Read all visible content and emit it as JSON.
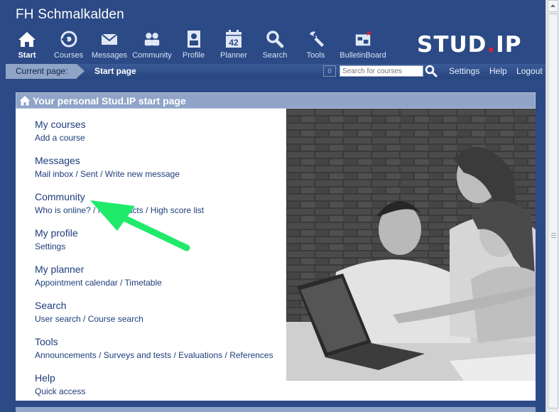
{
  "header": {
    "title": "FH Schmalkalden",
    "logo_main": "STUD",
    "logo_dot": ".",
    "logo_end": "IP"
  },
  "nav": [
    {
      "label": "Start",
      "icon": "home-icon",
      "active": true
    },
    {
      "label": "Courses",
      "icon": "courses-icon"
    },
    {
      "label": "Messages",
      "icon": "envelope-icon"
    },
    {
      "label": "Community",
      "icon": "people-icon"
    },
    {
      "label": "Profile",
      "icon": "profile-icon"
    },
    {
      "label": "Planner",
      "icon": "calendar-icon",
      "badge": "42"
    },
    {
      "label": "Search",
      "icon": "magnifier-icon"
    },
    {
      "label": "Tools",
      "icon": "wrench-icon"
    },
    {
      "label": "BulletinBoard",
      "icon": "bulletinboard-icon"
    }
  ],
  "bar": {
    "current_label": "Current page:",
    "current_page": "Start page",
    "count": "0",
    "search_placeholder": "Search for courses",
    "settings": "Settings",
    "help": "Help",
    "logout": "Logout"
  },
  "panel": {
    "title": "Your personal Stud.IP start page"
  },
  "sections": [
    {
      "title": "My courses",
      "links": [
        "Add a course"
      ]
    },
    {
      "title": "Messages",
      "links": [
        "Mail inbox",
        "Sent",
        "Write new message"
      ]
    },
    {
      "title": "Community",
      "links": [
        "Who is online?",
        "My contacts",
        "High score list"
      ]
    },
    {
      "title": "My profile",
      "links": [
        "Settings"
      ]
    },
    {
      "title": "My planner",
      "links": [
        "Appointment calendar",
        "Timetable"
      ]
    },
    {
      "title": "Search",
      "links": [
        "User search",
        "Course search"
      ]
    },
    {
      "title": "Tools",
      "links": [
        "Announcements",
        "Surveys and tests",
        "Evaluations",
        "References"
      ]
    },
    {
      "title": "Help",
      "links": [
        "Quick access"
      ]
    }
  ],
  "colors": {
    "brand": "#2c4a86",
    "accent": "#d8233a",
    "annotation_arrow": "#1fea6a"
  }
}
